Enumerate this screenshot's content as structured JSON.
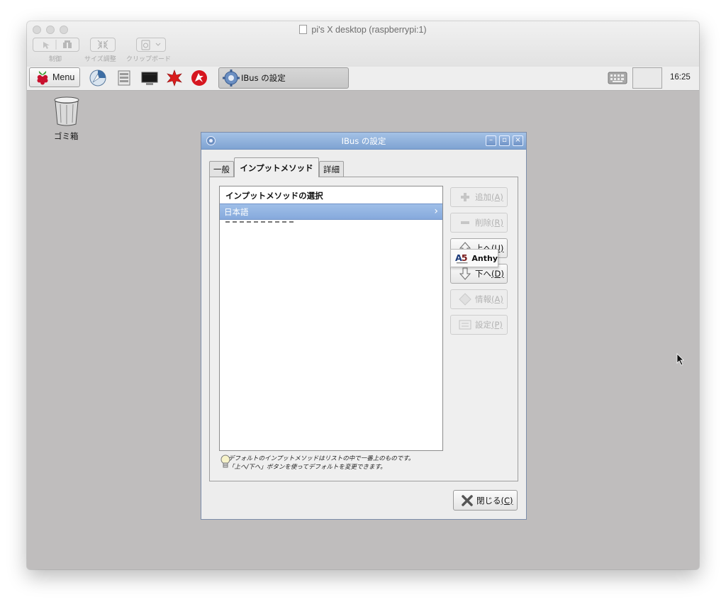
{
  "mac_window": {
    "title": "pi's X desktop (raspberrypi:1)",
    "toolbar": [
      {
        "label": "制御"
      },
      {
        "label": "サイズ調整"
      },
      {
        "label": "クリップボード"
      }
    ]
  },
  "panel": {
    "menu_label": "Menu",
    "task_label": "IBus の設定",
    "clock": "16:25",
    "icons": [
      "raspberry-icon",
      "browser-icon",
      "file-manager-icon",
      "terminal-icon",
      "mathematica-icon",
      "wolfram-icon",
      "keyboard-icon"
    ]
  },
  "desktop": {
    "trash_label": "ゴミ箱"
  },
  "dialog": {
    "title": "IBus の設定",
    "tabs": [
      {
        "label": "一般",
        "active": false
      },
      {
        "label": "インプットメソッド",
        "active": true
      },
      {
        "label": "詳細",
        "active": false
      }
    ],
    "list_header": "インプットメソッドの選択",
    "dropdown_selected": "日本語",
    "submenu_item": "Anthy",
    "buttons": [
      {
        "label": "追加",
        "mnemonic": "(A)",
        "enabled": false
      },
      {
        "label": "削除",
        "mnemonic": "(R)",
        "enabled": false
      },
      {
        "label": "上へ",
        "mnemonic": "(U)",
        "enabled": true
      },
      {
        "label": "下へ",
        "mnemonic": "(D)",
        "enabled": true
      },
      {
        "label": "情報",
        "mnemonic": "(A)",
        "enabled": false
      },
      {
        "label": "設定",
        "mnemonic": "(P)",
        "enabled": false
      }
    ],
    "hint_line1": "デフォルトのインプットメソッドはリストの中で一番上のものです。",
    "hint_line2": "「上へ/下へ」ボタンを使ってデフォルトを変更できます。",
    "close_label": "閉じる",
    "close_mnemonic": "(C)"
  },
  "colors": {
    "dialog_title": "#8aacd9",
    "selection": "#93b5e2",
    "desktop": "#bfbdbd"
  }
}
